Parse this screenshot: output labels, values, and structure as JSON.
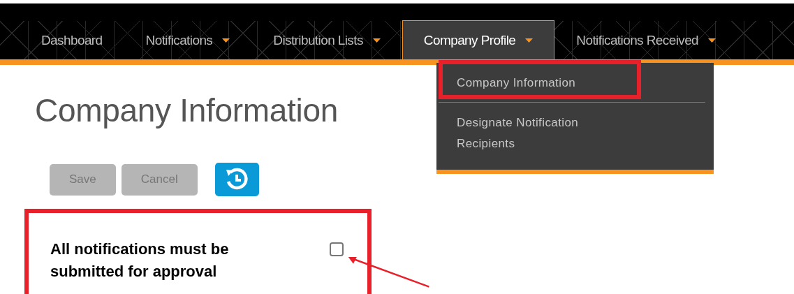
{
  "nav": {
    "items": [
      {
        "label": "Dashboard",
        "has_menu": false,
        "selected": false
      },
      {
        "label": "Notifications",
        "has_menu": true,
        "selected": false
      },
      {
        "label": "Distribution Lists",
        "has_menu": true,
        "selected": false
      },
      {
        "label": "Company Profile",
        "has_menu": true,
        "selected": true
      },
      {
        "label": "Notifications Received",
        "has_menu": true,
        "selected": false
      }
    ]
  },
  "dropdown": {
    "items": [
      {
        "label": "Company Information",
        "annotated": true
      },
      {
        "label": "Designate Notification Recipients",
        "annotated": false
      }
    ]
  },
  "page": {
    "title": "Company Information",
    "buttons": [
      {
        "label": "Save",
        "disabled": true
      },
      {
        "label": "Cancel",
        "disabled": true
      }
    ],
    "settings": [
      {
        "label": "All notifications must be submitted for approval",
        "checked": false,
        "annotated": true
      }
    ]
  }
}
